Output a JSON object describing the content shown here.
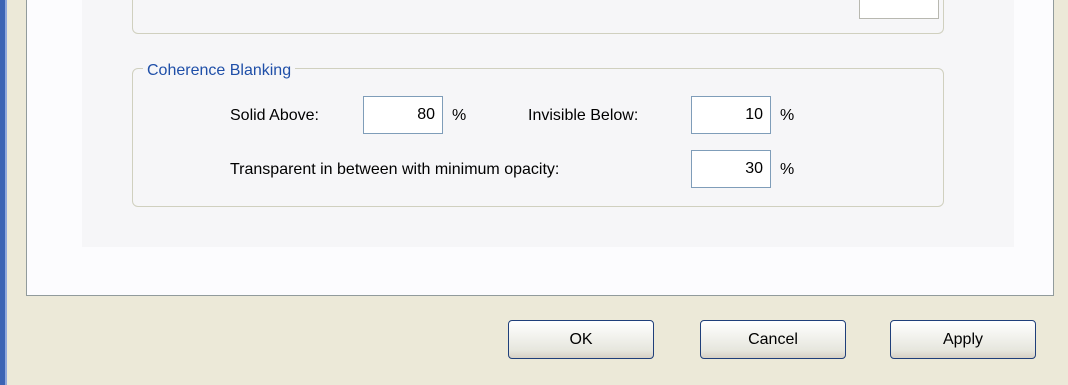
{
  "coherence_blanking": {
    "title": "Coherence Blanking",
    "solid_above": {
      "label": "Solid Above:",
      "value": "80",
      "unit": "%"
    },
    "invisible_below": {
      "label": "Invisible Below:",
      "value": "10",
      "unit": "%"
    },
    "min_opacity": {
      "label": "Transparent in between with minimum opacity:",
      "value": "30",
      "unit": "%"
    }
  },
  "buttons": {
    "ok": "OK",
    "cancel": "Cancel",
    "apply": "Apply"
  }
}
